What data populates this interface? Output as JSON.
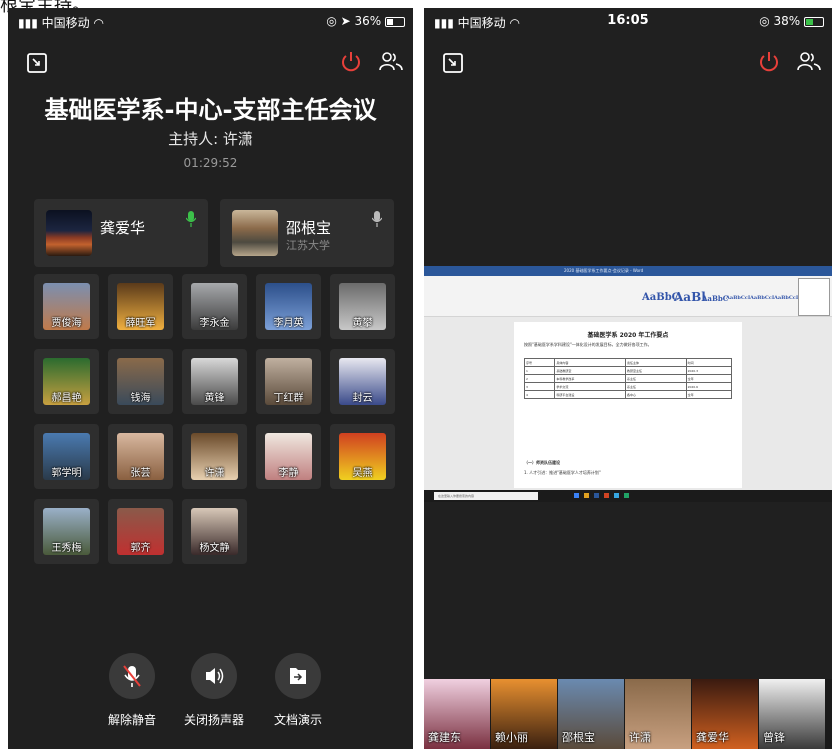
{
  "top_text": "根宝主持。",
  "left": {
    "status": {
      "carrier": "中国移动",
      "battery": "36%"
    },
    "meeting_title": "基础医学系-中心-支部主任会议",
    "host_label": "主持人: 许潇",
    "elapsed": "01:29:52",
    "featured": [
      {
        "name": "龚爱华",
        "sub": "",
        "mic": "active"
      },
      {
        "name": "邵根宝",
        "sub": "江苏大学",
        "mic": "idle"
      }
    ],
    "participants": [
      "贾俊海",
      "薛旺军",
      "李永金",
      "李月英",
      "黄攀",
      "郝昌艳",
      "钱海",
      "黄锋",
      "丁红群",
      "封云",
      "郭学明",
      "张芸",
      "许潇",
      "李静",
      "吴燕",
      "王秀梅",
      "郭齐",
      "杨文静"
    ],
    "controls": [
      {
        "label": "解除静音",
        "icon": "mic-muted-icon"
      },
      {
        "label": "关闭扬声器",
        "icon": "speaker-icon"
      },
      {
        "label": "文档演示",
        "icon": "share-doc-icon"
      }
    ]
  },
  "right": {
    "status": {
      "carrier": "中国移动",
      "time": "16:05",
      "battery": "38%"
    },
    "shared_doc": {
      "window_title": "2020 基础医学系工作要点-会议记录 - Word",
      "styles": [
        "AaBbC",
        "AaBl",
        "AaBbC",
        "AaBbCcI",
        "AaBbCcI",
        "AaBbCcI"
      ],
      "heading": "基础医学系 2020 年工作要点",
      "intro": "按照\"基础医学系学科建设\"一体化设计的发展目标，全力做好各项工作。",
      "rows": [
        [
          "序号",
          "具体内容",
          "责任主体",
          "时间"
        ],
        [
          "1",
          "基础教研室",
          "教研室主任",
          "2020.3"
        ],
        [
          "2",
          "本科教学改革",
          "系主任",
          "全年"
        ],
        [
          "3",
          "学术交流",
          "系主任",
          "2020.6"
        ],
        [
          "4",
          "科研平台建设",
          "各中心",
          "全年"
        ]
      ],
      "section": "（一）师资队伍建设",
      "item": "1. 人才引进：推进\"基础医学人才培养计划\"",
      "search_placeholder": "在这里输入你要搜索的内容"
    },
    "strip_names": [
      "龚建东",
      "赖小丽",
      "邵根宝",
      "许潇",
      "龚爱华",
      "曾锋"
    ]
  }
}
